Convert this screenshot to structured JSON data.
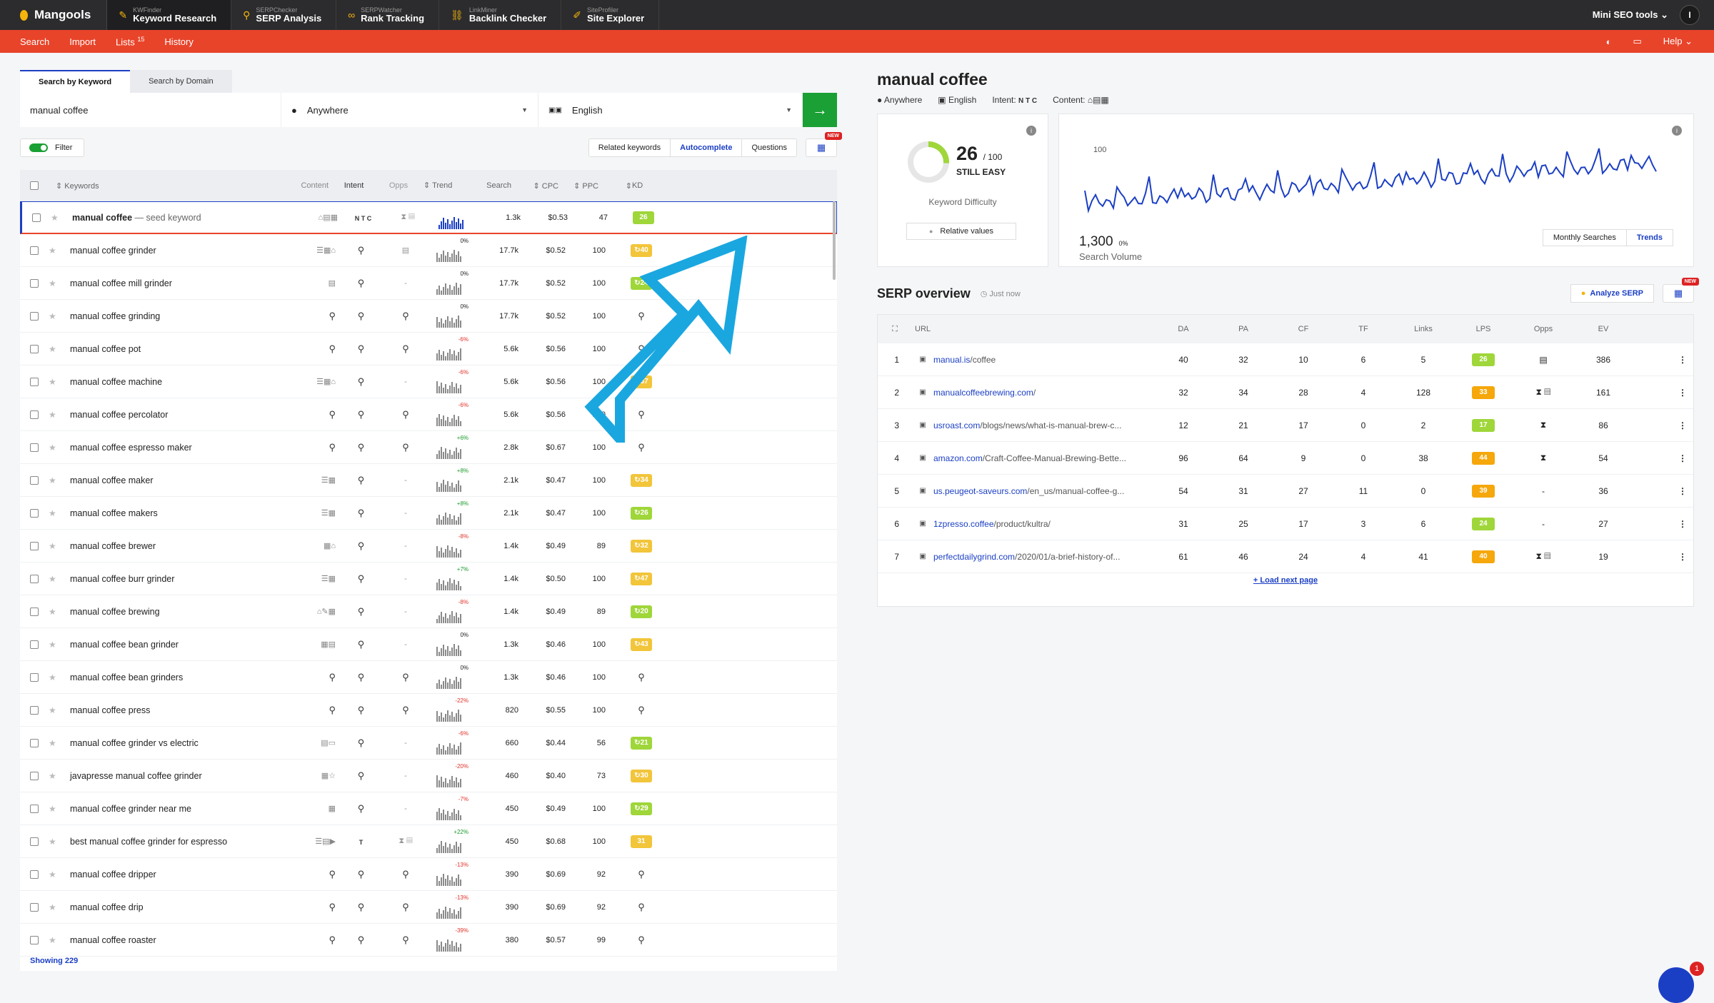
{
  "topbar": {
    "logo": "Mangools",
    "tools": [
      {
        "small": "KWFinder",
        "big": "Keyword Research",
        "icon": "search-icon"
      },
      {
        "small": "SERPChecker",
        "big": "SERP Analysis",
        "icon": "pin-icon"
      },
      {
        "small": "SERPWatcher",
        "big": "Rank Tracking",
        "icon": "glasses-icon"
      },
      {
        "small": "LinkMiner",
        "big": "Backlink Checker",
        "icon": "link-icon"
      },
      {
        "small": "SiteProfiler",
        "big": "Site Explorer",
        "icon": "wrench-icon"
      }
    ],
    "mini_tools": "Mini SEO tools",
    "avatar": "I"
  },
  "subnav": {
    "items": [
      "Search",
      "Import",
      "Lists",
      "History"
    ],
    "lists_count": "15",
    "help": "Help"
  },
  "search": {
    "tab_keyword": "Search by Keyword",
    "tab_domain": "Search by Domain",
    "keyword": "manual coffee",
    "location": "Anywhere",
    "language": "English",
    "filter": "Filter",
    "segments": [
      "Related keywords",
      "Autocomplete",
      "Questions"
    ],
    "new_badge": "NEW"
  },
  "table": {
    "headers": [
      "Keywords",
      "Content",
      "Intent",
      "Opps",
      "Trend",
      "Search",
      "CPC",
      "PPC",
      "KD"
    ],
    "rows": [
      {
        "kw": "manual coffee",
        "suffix": " — seed keyword",
        "sv": "1.3k",
        "cpc": "$0.53",
        "ppc": "47",
        "kd": "26",
        "pct": "",
        "content": "⌂▤▦",
        "intent": "N T C",
        "opps": "⧗ ▤"
      },
      {
        "kw": "manual coffee grinder",
        "sv": "17.7k",
        "cpc": "$0.52",
        "ppc": "100",
        "kd": "40",
        "pct": "0%",
        "content": "☰▦⌂",
        "intent": "",
        "opps": "▤"
      },
      {
        "kw": "manual coffee mill grinder",
        "sv": "17.7k",
        "cpc": "$0.52",
        "ppc": "100",
        "kd": "24",
        "pct": "0%",
        "content": "▤",
        "intent": "",
        "opps": "-"
      },
      {
        "kw": "manual coffee grinding",
        "sv": "17.7k",
        "cpc": "$0.52",
        "ppc": "100",
        "kd": "",
        "pct": "0%",
        "content": "",
        "intent": "",
        "opps": ""
      },
      {
        "kw": "manual coffee pot",
        "sv": "5.6k",
        "cpc": "$0.56",
        "ppc": "100",
        "kd": "",
        "pct": "-6%",
        "content": "",
        "intent": "",
        "opps": ""
      },
      {
        "kw": "manual coffee machine",
        "sv": "5.6k",
        "cpc": "$0.56",
        "ppc": "100",
        "kd": "37",
        "pct": "-6%",
        "content": "☰▦⌂",
        "intent": "",
        "opps": "-"
      },
      {
        "kw": "manual coffee percolator",
        "sv": "5.6k",
        "cpc": "$0.56",
        "ppc": "100",
        "kd": "",
        "pct": "-6%",
        "content": "",
        "intent": "",
        "opps": ""
      },
      {
        "kw": "manual coffee espresso maker",
        "sv": "2.8k",
        "cpc": "$0.67",
        "ppc": "100",
        "kd": "",
        "pct": "+6%",
        "content": "",
        "intent": "",
        "opps": ""
      },
      {
        "kw": "manual coffee maker",
        "sv": "2.1k",
        "cpc": "$0.47",
        "ppc": "100",
        "kd": "34",
        "pct": "+8%",
        "content": "☰▦",
        "intent": "",
        "opps": "-"
      },
      {
        "kw": "manual coffee makers",
        "sv": "2.1k",
        "cpc": "$0.47",
        "ppc": "100",
        "kd": "26",
        "pct": "+8%",
        "content": "☰▦",
        "intent": "",
        "opps": "-"
      },
      {
        "kw": "manual coffee brewer",
        "sv": "1.4k",
        "cpc": "$0.49",
        "ppc": "89",
        "kd": "32",
        "pct": "-8%",
        "content": "▦⌂",
        "intent": "",
        "opps": "-"
      },
      {
        "kw": "manual coffee burr grinder",
        "sv": "1.4k",
        "cpc": "$0.50",
        "ppc": "100",
        "kd": "47",
        "pct": "+7%",
        "content": "☰▦",
        "intent": "",
        "opps": "-"
      },
      {
        "kw": "manual coffee brewing",
        "sv": "1.4k",
        "cpc": "$0.49",
        "ppc": "89",
        "kd": "20",
        "pct": "-8%",
        "content": "⌂✎▦",
        "intent": "",
        "opps": "-"
      },
      {
        "kw": "manual coffee bean grinder",
        "sv": "1.3k",
        "cpc": "$0.46",
        "ppc": "100",
        "kd": "43",
        "pct": "0%",
        "content": "▦▤",
        "intent": "",
        "opps": "-"
      },
      {
        "kw": "manual coffee bean grinders",
        "sv": "1.3k",
        "cpc": "$0.46",
        "ppc": "100",
        "kd": "",
        "pct": "0%",
        "content": "",
        "intent": "",
        "opps": ""
      },
      {
        "kw": "manual coffee press",
        "sv": "820",
        "cpc": "$0.55",
        "ppc": "100",
        "kd": "",
        "pct": "-22%",
        "content": "",
        "intent": "",
        "opps": ""
      },
      {
        "kw": "manual coffee grinder vs electric",
        "sv": "660",
        "cpc": "$0.44",
        "ppc": "56",
        "kd": "21",
        "pct": "-6%",
        "content": "▤▭",
        "intent": "",
        "opps": "-"
      },
      {
        "kw": "javapresse manual coffee grinder",
        "sv": "460",
        "cpc": "$0.40",
        "ppc": "73",
        "kd": "30",
        "pct": "-20%",
        "content": "▦☆",
        "intent": "",
        "opps": "-"
      },
      {
        "kw": "manual coffee grinder near me",
        "sv": "450",
        "cpc": "$0.49",
        "ppc": "100",
        "kd": "29",
        "pct": "-7%",
        "content": "▦",
        "intent": "",
        "opps": "-"
      },
      {
        "kw": "best manual coffee grinder for espresso",
        "sv": "450",
        "cpc": "$0.68",
        "ppc": "100",
        "kd": "31",
        "pct": "+22%",
        "content": "☰▤▶",
        "intent": "T",
        "opps": "⧗ ▤"
      },
      {
        "kw": "manual coffee dripper",
        "sv": "390",
        "cpc": "$0.69",
        "ppc": "92",
        "kd": "",
        "pct": "-13%",
        "content": "",
        "intent": "",
        "opps": ""
      },
      {
        "kw": "manual coffee drip",
        "sv": "390",
        "cpc": "$0.69",
        "ppc": "92",
        "kd": "",
        "pct": "-13%",
        "content": "",
        "intent": "",
        "opps": ""
      },
      {
        "kw": "manual coffee roaster",
        "sv": "380",
        "cpc": "$0.57",
        "ppc": "99",
        "kd": "",
        "pct": "-39%",
        "content": "",
        "intent": "",
        "opps": ""
      }
    ],
    "showing": "Showing 229"
  },
  "detail": {
    "title": "manual coffee",
    "location": "Anywhere",
    "language": "English",
    "intent_label": "Intent:",
    "intent": "N T C",
    "content_label": "Content:",
    "kd_value": "26",
    "kd_max": "/ 100",
    "kd_text": "STILL EASY",
    "kd_label": "Keyword Difficulty",
    "relative": "Relative values",
    "trend_axis": "100",
    "sv_value": "1,300",
    "sv_pct": "0%",
    "sv_label": "Search Volume",
    "monthly": "Monthly Searches",
    "trends": "Trends"
  },
  "serp": {
    "title": "SERP overview",
    "time": "Just now",
    "analyze": "Analyze SERP",
    "headers": [
      "URL",
      "DA",
      "PA",
      "CF",
      "TF",
      "Links",
      "LPS",
      "Opps",
      "EV"
    ],
    "rows": [
      {
        "n": "1",
        "domain": "manual.is",
        "path": "/coffee",
        "da": "40",
        "pa": "32",
        "cf": "10",
        "tf": "6",
        "links": "5",
        "lps": "26",
        "opps": "▤",
        "ev": "386"
      },
      {
        "n": "2",
        "domain": "manualcoffeebrewing.com",
        "path": "/",
        "da": "32",
        "pa": "34",
        "cf": "28",
        "tf": "4",
        "links": "128",
        "lps": "33",
        "opps": "⧗ ▤",
        "ev": "161"
      },
      {
        "n": "3",
        "domain": "usroast.com",
        "path": "/blogs/news/what-is-manual-brew-c...",
        "da": "12",
        "pa": "21",
        "cf": "17",
        "tf": "0",
        "links": "2",
        "lps": "17",
        "opps": "⧗",
        "ev": "86"
      },
      {
        "n": "4",
        "domain": "amazon.com",
        "path": "/Craft-Coffee-Manual-Brewing-Bette...",
        "da": "96",
        "pa": "64",
        "cf": "9",
        "tf": "0",
        "links": "38",
        "lps": "44",
        "opps": "⧗",
        "ev": "54"
      },
      {
        "n": "5",
        "domain": "us.peugeot-saveurs.com",
        "path": "/en_us/manual-coffee-g...",
        "da": "54",
        "pa": "31",
        "cf": "27",
        "tf": "11",
        "links": "0",
        "lps": "39",
        "opps": "-",
        "ev": "36"
      },
      {
        "n": "6",
        "domain": "1zpresso.coffee",
        "path": "/product/kultra/",
        "da": "31",
        "pa": "25",
        "cf": "17",
        "tf": "3",
        "links": "6",
        "lps": "24",
        "opps": "-",
        "ev": "27"
      },
      {
        "n": "7",
        "domain": "perfectdailygrind.com",
        "path": "/2020/01/a-brief-history-of...",
        "da": "61",
        "pa": "46",
        "cf": "24",
        "tf": "4",
        "links": "41",
        "lps": "40",
        "opps": "⧗ ▤",
        "ev": "19"
      }
    ],
    "load_next": "Load next page"
  },
  "chat_badge": "1",
  "colors": {
    "accent": "#e8442a",
    "primary": "#1b3fc4",
    "go": "#1aa034",
    "kd_easy": "#9fd63a",
    "kd_mid": "#f2c53a",
    "lps_mid": "#f5a70b",
    "arrow": "#1aa7e0"
  }
}
